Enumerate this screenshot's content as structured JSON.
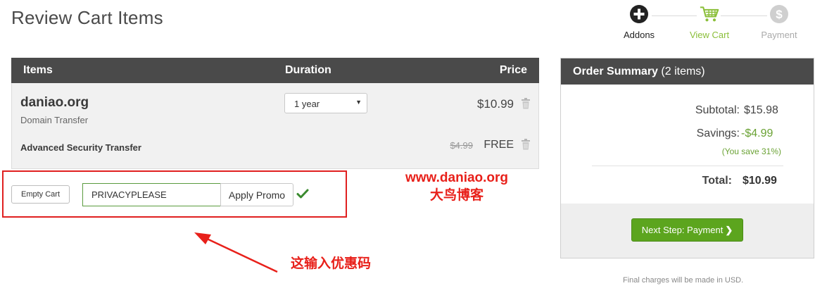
{
  "page": {
    "title": "Review Cart Items"
  },
  "steps": [
    {
      "label": "Addons",
      "icon": "plus-circle-icon",
      "color": "#222222"
    },
    {
      "label": "View Cart",
      "icon": "cart-icon",
      "color": "#8bbf3a"
    },
    {
      "label": "Payment",
      "icon": "dollar-circle-icon",
      "color": "#cccccc"
    }
  ],
  "cart": {
    "headers": {
      "items": "Items",
      "duration": "Duration",
      "price": "Price"
    },
    "item": {
      "name": "daniao.org",
      "type": "Domain Transfer",
      "duration": "1 year",
      "price": "$10.99"
    },
    "addon": {
      "name": "Advanced Security Transfer",
      "old_price": "$4.99",
      "price": "FREE"
    }
  },
  "promo": {
    "empty_cart_label": "Empty Cart",
    "code": "PRIVACYPLEASE",
    "apply_label": "Apply Promo",
    "applied": true
  },
  "annotations": {
    "watermark_url": "www.daniao.org",
    "watermark_name": "大鸟博客",
    "hint": "这输入优惠码"
  },
  "summary": {
    "title": "Order Summary",
    "count": "(2 items)",
    "subtotal_label": "Subtotal:",
    "subtotal": "$15.98",
    "savings_label": "Savings:",
    "savings": "-$4.99",
    "you_save": "(You save 31%)",
    "total_label": "Total:",
    "total": "$10.99",
    "next_label": "Next Step: Payment",
    "final_note": "Final charges will be made in USD."
  },
  "colors": {
    "accent_green": "#5ca51e",
    "header_dark": "#4a4a4a",
    "annotation_red": "#e8201a"
  }
}
